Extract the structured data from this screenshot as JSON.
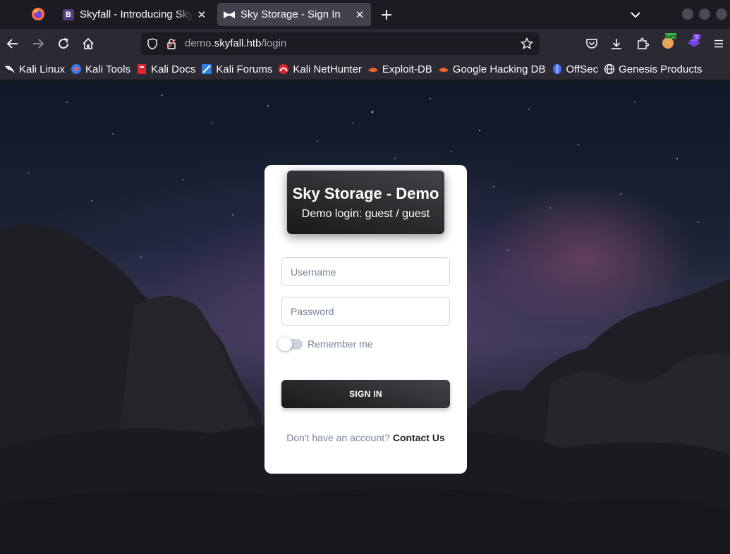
{
  "browser": {
    "tabs": [
      {
        "title": "Skyfall - Introducing Sky",
        "favicon": "bootstrap-b-icon",
        "favicon_letter": "B",
        "active": false
      },
      {
        "title": "Sky Storage - Sign In",
        "favicon": "bowtie-icon",
        "active": true
      }
    ],
    "url_prefix": "demo.",
    "url_domain": "skyfall.htb",
    "url_path": "/login",
    "extension_badge": "9",
    "burp_label": "burp"
  },
  "bookmarks": [
    {
      "label": "Kali Linux",
      "icon": "kali-dragon-icon"
    },
    {
      "label": "Kali Tools",
      "icon": "kali-tools-icon"
    },
    {
      "label": "Kali Docs",
      "icon": "kali-docs-icon"
    },
    {
      "label": "Kali Forums",
      "icon": "kali-forums-icon"
    },
    {
      "label": "Kali NetHunter",
      "icon": "nethunter-icon"
    },
    {
      "label": "Exploit-DB",
      "icon": "exploit-db-icon"
    },
    {
      "label": "Google Hacking DB",
      "icon": "ghdb-icon"
    },
    {
      "label": "OffSec",
      "icon": "offsec-icon"
    },
    {
      "label": "Genesis Products",
      "icon": "globe-icon"
    }
  ],
  "login": {
    "title": "Sky Storage - Demo",
    "subtitle": "Demo login: guest / guest",
    "username_placeholder": "Username",
    "password_placeholder": "Password",
    "remember_label": "Remember me",
    "remember_checked": false,
    "signin_label": "SIGN IN",
    "signup_prompt": "Don't have an account?",
    "signup_link": "Contact Us"
  },
  "colors": {
    "card_header": "#191919",
    "muted_text": "#7b809a",
    "browser_chrome": "#2b2a33",
    "tab_strip": "#1c1b22"
  }
}
